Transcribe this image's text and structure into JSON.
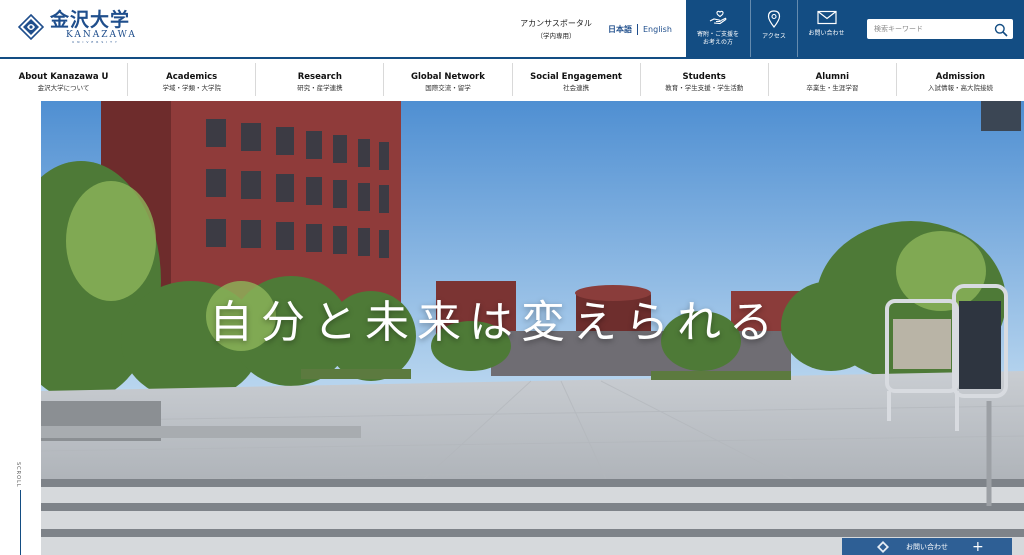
{
  "header": {
    "logo_jp": "金沢大学",
    "logo_en": "KANAZAWA",
    "logo_sub": "UNIVERSITY",
    "portal_label": "アカンサスポータル",
    "portal_sub": "（学内専用）",
    "lang_ja": "日本語",
    "lang_en": "English",
    "quick_links": [
      {
        "icon": "donate-hand-icon",
        "label": "寄附・ご支援を",
        "label2": "お考えの方"
      },
      {
        "icon": "map-pin-icon",
        "label": "アクセス"
      },
      {
        "icon": "mail-icon",
        "label": "お問い合わせ"
      }
    ],
    "search": {
      "placeholder": "検索キーワード"
    }
  },
  "nav": [
    {
      "en": "About Kanazawa U",
      "jp": "金沢大学について"
    },
    {
      "en": "Academics",
      "jp": "学域・学類・大学院"
    },
    {
      "en": "Research",
      "jp": "研究・産学連携"
    },
    {
      "en": "Global Network",
      "jp": "国際交流・留学"
    },
    {
      "en": "Social Engagement",
      "jp": "社会連携"
    },
    {
      "en": "Students",
      "jp": "教育・学生支援・学生活動"
    },
    {
      "en": "Alumni",
      "jp": "卒業生・生涯学習"
    },
    {
      "en": "Admission",
      "jp": "入試情報・高大院接続"
    }
  ],
  "hero": {
    "copy": "自分と未来は変えられる",
    "scroll_label": "SCROLL"
  },
  "contact_tab": {
    "label": "お問い合わせ",
    "plus": "+"
  },
  "colors": {
    "navy": "#134d83",
    "brand_blue": "#1f4e8c",
    "tab_blue": "#2e5f95"
  }
}
